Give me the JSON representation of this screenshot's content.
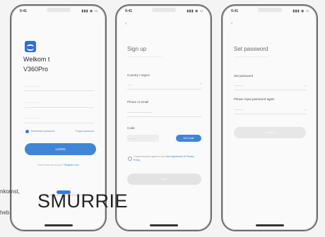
{
  "phone1": {
    "time": "9:41",
    "signal": "▮▮▮ ◉ ▭",
    "welcome": "Welkom t",
    "app_name": "V360Pro",
    "hint": "……",
    "account_placeholder": "——————",
    "password_placeholder": "——————",
    "remember_label": "Remember password",
    "forgot_label": "Forgot password",
    "login_label": "LOGIN",
    "no_account": "Don't have an account?",
    "register": "Register now"
  },
  "phone2": {
    "time": "9:41",
    "signal": "▮▮▮ ◉ ▭",
    "back": "‹",
    "title": "Sign up",
    "subtitle": "——————————————",
    "country_label": "Country / region",
    "country_value": "——",
    "chevron": "›",
    "phone_label": "Phone or email",
    "phone_placeholder": "——————————",
    "code_label": "Code",
    "code_placeholder": "———",
    "get_code": "Get Code",
    "agree_text": "I have read and agree to the",
    "agree_link": "User Agreement & Privacy Policy",
    "next_label": "Next"
  },
  "phone3": {
    "time": "9:41",
    "signal": "▮▮▮ ◉ ▭",
    "back": "‹",
    "title": "Set password",
    "subtitle": "——————————————",
    "pw_label": "Set password",
    "pw_placeholder": "————",
    "confirm_label": "Please input password again",
    "confirm_placeholder": "————",
    "eye": "◡",
    "confirm_btn": "Confirm"
  },
  "overlay": {
    "cut_text_1": "nkomst,",
    "cut_text_2": "heb",
    "big_text": "SMURRIE"
  },
  "colors": {
    "accent": "#3f86d8",
    "disabled": "#e3e3e3"
  }
}
